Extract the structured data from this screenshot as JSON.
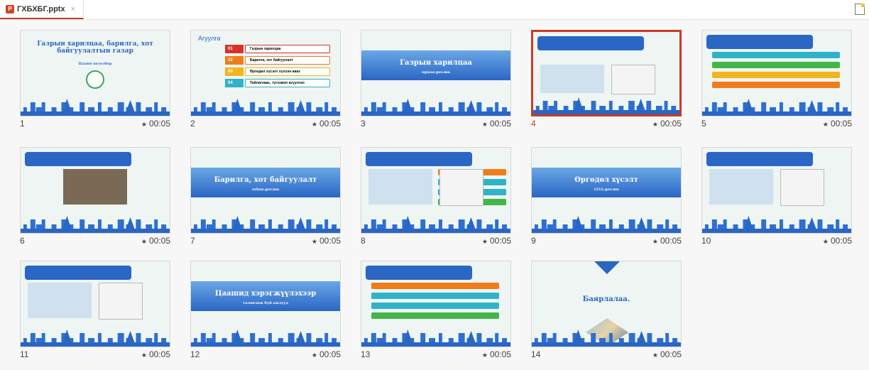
{
  "tab": {
    "file_name": "ГХБХБГ.pptx",
    "close_glyph": "×",
    "icon": "powerpoint-file-icon"
  },
  "new_button_icon": "new-document-icon",
  "colors": {
    "accent": "#c73c24",
    "slide_blue": "#2a66c4"
  },
  "slides": [
    {
      "number": "1",
      "duration": "00:05",
      "title": "Газрын харилцаа, барилга, хот байгуулалтын газар",
      "subtitle": "Цахим хөтөлбөр"
    },
    {
      "number": "2",
      "duration": "00:05",
      "title": "Агуулга",
      "items": [
        {
          "n": "01",
          "t": "Газрын харилцаа"
        },
        {
          "n": "02",
          "t": "Барилга, хот байгуулалт"
        },
        {
          "n": "03",
          "t": "Өргөдөл хүсэлт хүлээн авах"
        },
        {
          "n": "04",
          "t": "Тайлагнаас, түгээмэл асуулгал"
        }
      ]
    },
    {
      "number": "3",
      "duration": "00:05",
      "title": "Газрын харилцаа",
      "subtitle": "egazar.gov.mn"
    },
    {
      "number": "4",
      "duration": "00:05",
      "selected": true
    },
    {
      "number": "5",
      "duration": "00:05"
    },
    {
      "number": "6",
      "duration": "00:05"
    },
    {
      "number": "7",
      "duration": "00:05",
      "title": "Барилга, хот байгуулалт",
      "subtitle": "urban.gov.mn"
    },
    {
      "number": "8",
      "duration": "00:05"
    },
    {
      "number": "9",
      "duration": "00:05",
      "title": "Өргөдөл хүсэлт",
      "subtitle": "1212.gov.mn"
    },
    {
      "number": "10",
      "duration": "00:05"
    },
    {
      "number": "11",
      "duration": "00:05"
    },
    {
      "number": "12",
      "duration": "00:05",
      "title": "Цаашид хэрэгжүүлэхээр",
      "subtitle": "төлөвлөж буй ажлууд"
    },
    {
      "number": "13",
      "duration": "00:05"
    },
    {
      "number": "14",
      "duration": "00:05",
      "title": "Баярлалаа."
    }
  ]
}
